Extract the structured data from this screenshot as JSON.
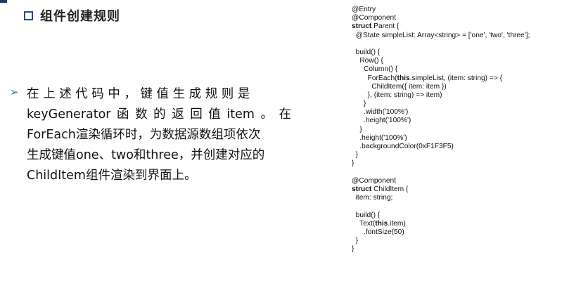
{
  "title": "组件创建规则",
  "bullet_lines": [
    "在 上 述 代 码 中 ， 键 值 生 成 规 则 是",
    "keyGenerator函数的返回值item。在",
    "ForEach渲染循环时，为数据源数组项依次",
    "生成键值one、two和three，并创建对应的",
    "ChildItem组件渲染到界面上。"
  ],
  "code_lines": [
    "@Entry",
    "@Component",
    "struct Parent {",
    "  @State simpleList: Array<string> = ['one', 'two', 'three'];",
    "",
    "  build() {",
    "    Row() {",
    "      Column() {",
    "        ForEach(this.simpleList, (item: string) => {",
    "          ChildItem({ item: item })",
    "        }, (item: string) => item)",
    "      }",
    "      .width('100%')",
    "      .height('100%')",
    "    }",
    "    .height('100%')",
    "    .backgroundColor(0xF1F3F5)",
    "  }",
    "}",
    "",
    "@Component",
    "struct ChildItem {",
    "  item: string;",
    "",
    "  build() {",
    "    Text(this.item)",
    "      .fontSize(50)",
    "  }",
    "}"
  ]
}
